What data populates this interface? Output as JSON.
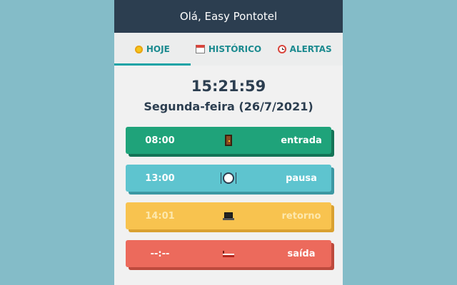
{
  "header": {
    "title": "Olá, Easy Pontotel"
  },
  "tabs": [
    {
      "label": "HOJE",
      "icon": "sun-icon",
      "active": true
    },
    {
      "label": "HISTÓRICO",
      "icon": "calendar-icon",
      "active": false
    },
    {
      "label": "ALERTAS",
      "icon": "alarm-clock-icon",
      "active": false
    }
  ],
  "today": {
    "clock": "15:21:59",
    "date": "Segunda-feira (26/7/2021)"
  },
  "punches": [
    {
      "time": "08:00",
      "icon": "door-icon",
      "label": "entrada",
      "color": "#1fa37a"
    },
    {
      "time": "13:00",
      "icon": "plate-icon",
      "label": "pausa",
      "color": "#5ec4cf"
    },
    {
      "time": "14:01",
      "icon": "laptop-icon",
      "label": "retorno",
      "color": "#f8c34f"
    },
    {
      "time": "--:--",
      "icon": "bed-icon",
      "label": "saída",
      "color": "#ec6a5c"
    }
  ],
  "colors": {
    "header_bg": "#2c3e50",
    "tab_accent": "#16a3a6",
    "page_bg": "#84bcc8"
  }
}
